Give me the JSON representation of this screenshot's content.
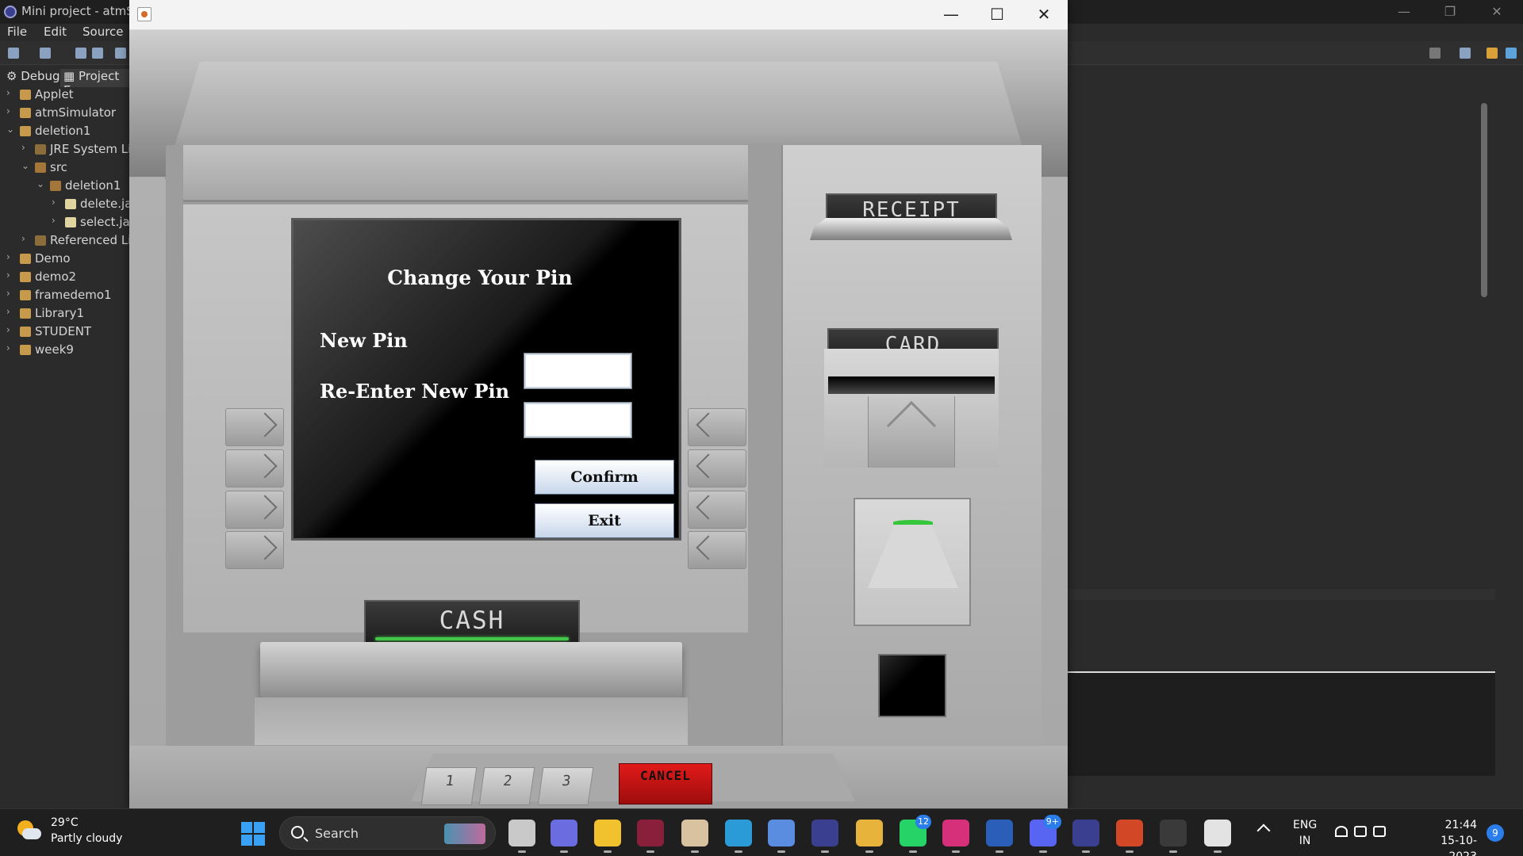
{
  "eclipse": {
    "title": "Mini project - atmSi",
    "menu": [
      "File",
      "Edit",
      "Source"
    ],
    "tabs": [
      "Debug",
      "Project Ex"
    ],
    "tree": [
      {
        "label": "Applet",
        "depth": 0,
        "expanded": false,
        "icon": "project-icon"
      },
      {
        "label": "atmSimulator",
        "depth": 0,
        "expanded": false,
        "icon": "project-icon"
      },
      {
        "label": "deletion1",
        "depth": 0,
        "expanded": true,
        "icon": "project-icon"
      },
      {
        "label": "JRE System Libr",
        "depth": 1,
        "expanded": false,
        "icon": "library-icon"
      },
      {
        "label": "src",
        "depth": 1,
        "expanded": true,
        "icon": "source-folder-icon"
      },
      {
        "label": "deletion1",
        "depth": 2,
        "expanded": true,
        "icon": "package-icon"
      },
      {
        "label": "delete.jav",
        "depth": 3,
        "expanded": false,
        "icon": "java-file-icon"
      },
      {
        "label": "select.jav",
        "depth": 3,
        "expanded": false,
        "icon": "java-file-icon"
      },
      {
        "label": "Referenced Libr",
        "depth": 1,
        "expanded": false,
        "icon": "library-icon"
      },
      {
        "label": "Demo",
        "depth": 0,
        "expanded": false,
        "icon": "project-icon"
      },
      {
        "label": "demo2",
        "depth": 0,
        "expanded": false,
        "icon": "project-icon"
      },
      {
        "label": "framedemo1",
        "depth": 0,
        "expanded": false,
        "icon": "project-icon"
      },
      {
        "label": "Library1",
        "depth": 0,
        "expanded": false,
        "icon": "project-icon"
      },
      {
        "label": "STUDENT",
        "depth": 0,
        "expanded": false,
        "icon": "project-icon"
      },
      {
        "label": "week9",
        "depth": 0,
        "expanded": false,
        "icon": "project-icon"
      }
    ]
  },
  "atm": {
    "window_controls": {
      "minimize": "—",
      "maximize": "☐",
      "close": "✕"
    },
    "screen": {
      "title": "Change Your Pin",
      "new_pin_label": "New Pin",
      "reenter_label": "Re-Enter New Pin",
      "new_pin_value": "",
      "reenter_value": "",
      "confirm_label": "Confirm",
      "exit_label": "Exit"
    },
    "receipt_label": "RECEIPT",
    "card_label": "CARD",
    "cash_label": "CASH",
    "keypad": [
      "1",
      "2",
      "3"
    ],
    "cancel_label": "CANCEL",
    "led_color": "#43c84a"
  },
  "taskbar": {
    "weather_temp": "29°C",
    "weather_desc": "Partly cloudy",
    "search_label": "Search",
    "apps": [
      {
        "name": "task-view-icon",
        "badge": ""
      },
      {
        "name": "meet-icon",
        "badge": ""
      },
      {
        "name": "file-explorer-icon",
        "badge": ""
      },
      {
        "name": "media-app-icon",
        "badge": ""
      },
      {
        "name": "photos-app-icon",
        "badge": ""
      },
      {
        "name": "edge-icon",
        "badge": ""
      },
      {
        "name": "vpn-icon",
        "badge": ""
      },
      {
        "name": "eclipse-icon",
        "badge": ""
      },
      {
        "name": "chrome-icon",
        "badge": ""
      },
      {
        "name": "whatsapp-icon",
        "badge": "12"
      },
      {
        "name": "instagram-icon",
        "badge": ""
      },
      {
        "name": "word-icon",
        "badge": ""
      },
      {
        "name": "discord-icon",
        "badge": "9+"
      },
      {
        "name": "eclipse-icon-2",
        "badge": ""
      },
      {
        "name": "powerpoint-icon",
        "badge": ""
      },
      {
        "name": "terminal-icon",
        "badge": ""
      },
      {
        "name": "java-icon",
        "badge": ""
      }
    ],
    "lang_top": "ENG",
    "lang_bottom": "IN",
    "time": "21:44",
    "date": "15-10-2023",
    "notification_count": "9"
  }
}
